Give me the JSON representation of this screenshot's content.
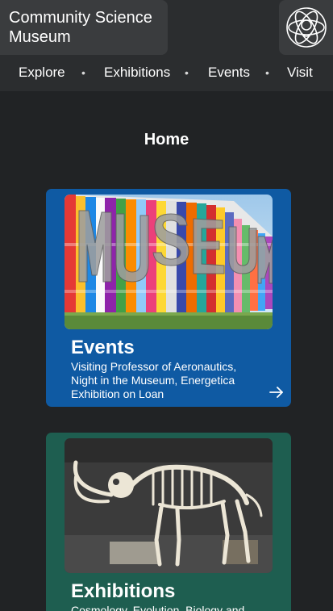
{
  "header": {
    "site_title": "Community Science Museum",
    "logo_icon": "atom-logo-icon"
  },
  "nav": {
    "items": [
      "Explore",
      "Exhibitions",
      "Events",
      "Visit"
    ],
    "separator": "•"
  },
  "page": {
    "title": "Home"
  },
  "cards": [
    {
      "title": "Events",
      "description": "Visiting Professor of Aeronautics, Night in the Museum, Energetica Exhibition on Loan",
      "image": "museum-sign-photo",
      "arrow_icon": "arrow-right-icon",
      "color": "#0f5aa3"
    },
    {
      "title": "Exhibitions",
      "description": "Cosmology, Evolution, Biology and",
      "image": "mammoth-skeleton-photo",
      "color": "#1e5e50"
    }
  ]
}
